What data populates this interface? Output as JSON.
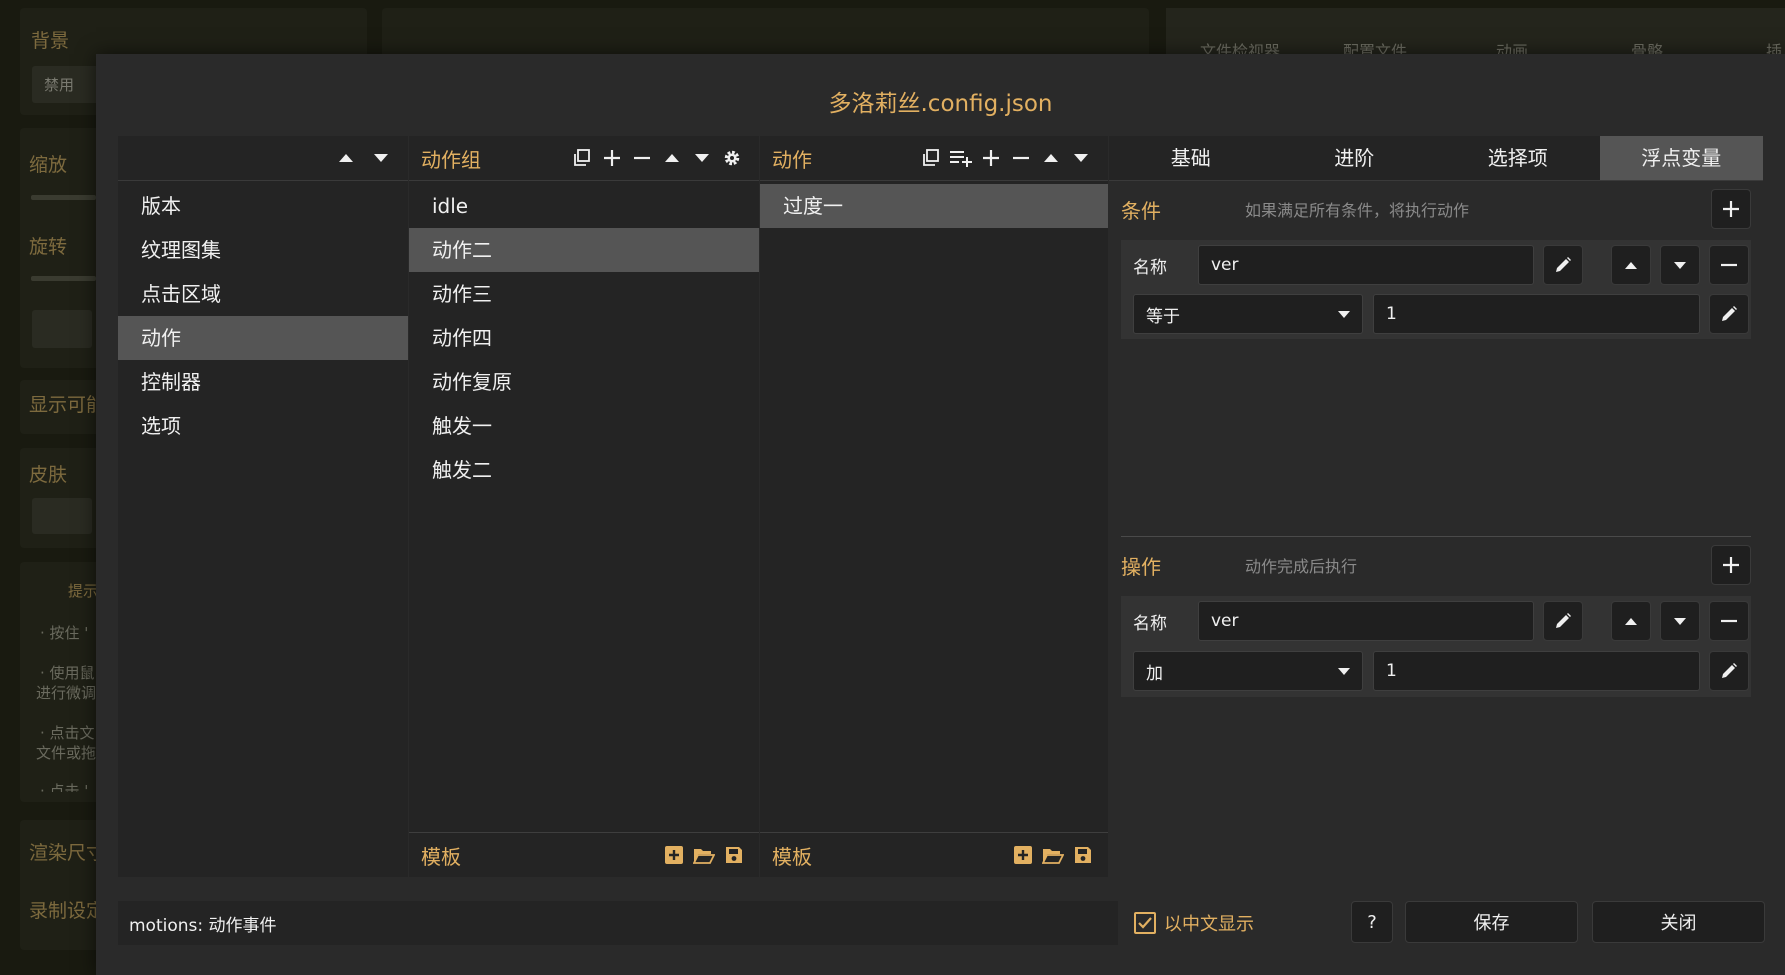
{
  "background": {
    "labels": [
      "背景",
      "缩放",
      "旋转",
      "显示可能",
      "皮肤",
      "渲染尺寸",
      "录制设定"
    ],
    "disabled_field": "禁用",
    "hint_title": "提示",
    "hints": [
      "· 按住 '",
      "· 使用鼠",
      "进行微调",
      "· 点击文",
      "文件或拖",
      "· 点击 '"
    ],
    "tabs": [
      "文件检视器",
      "配置文件",
      "动画",
      "骨骼",
      "插"
    ]
  },
  "dialog": {
    "title": "多洛莉丝.config.json",
    "categories": {
      "items": [
        "版本",
        "纹理图集",
        "点击区域",
        "动作",
        "控制器",
        "选项"
      ],
      "selected_index": 3
    },
    "motion_groups": {
      "title": "动作组",
      "items": [
        "idle",
        "动作二",
        "动作三",
        "动作四",
        "动作复原",
        "触发一",
        "触发二"
      ],
      "selected_index": 1,
      "footer_title": "模板"
    },
    "motions": {
      "title": "动作",
      "items": [
        "过度一"
      ],
      "selected_index": 0,
      "footer_title": "模板"
    },
    "tabs": {
      "items": [
        "基础",
        "进阶",
        "选择项",
        "浮点变量"
      ],
      "active_index": 3
    },
    "conditions": {
      "title": "条件",
      "hint": "如果满足所有条件，将执行动作",
      "name_label": "名称",
      "name_value": "ver",
      "operator": "等于",
      "value": "1"
    },
    "operations": {
      "title": "操作",
      "hint": "动作完成后执行",
      "name_label": "名称",
      "name_value": "ver",
      "operator": "加",
      "value": "1"
    },
    "status_text": "motions: 动作事件",
    "show_chinese_label": "以中文显示",
    "show_chinese_checked": true,
    "help_label": "?",
    "save_label": "保存",
    "close_label": "关闭"
  },
  "colors": {
    "accent": "#e2b061",
    "selected_row": "#555555",
    "panel": "#242424",
    "dialog_bg": "#2a2a2a"
  }
}
